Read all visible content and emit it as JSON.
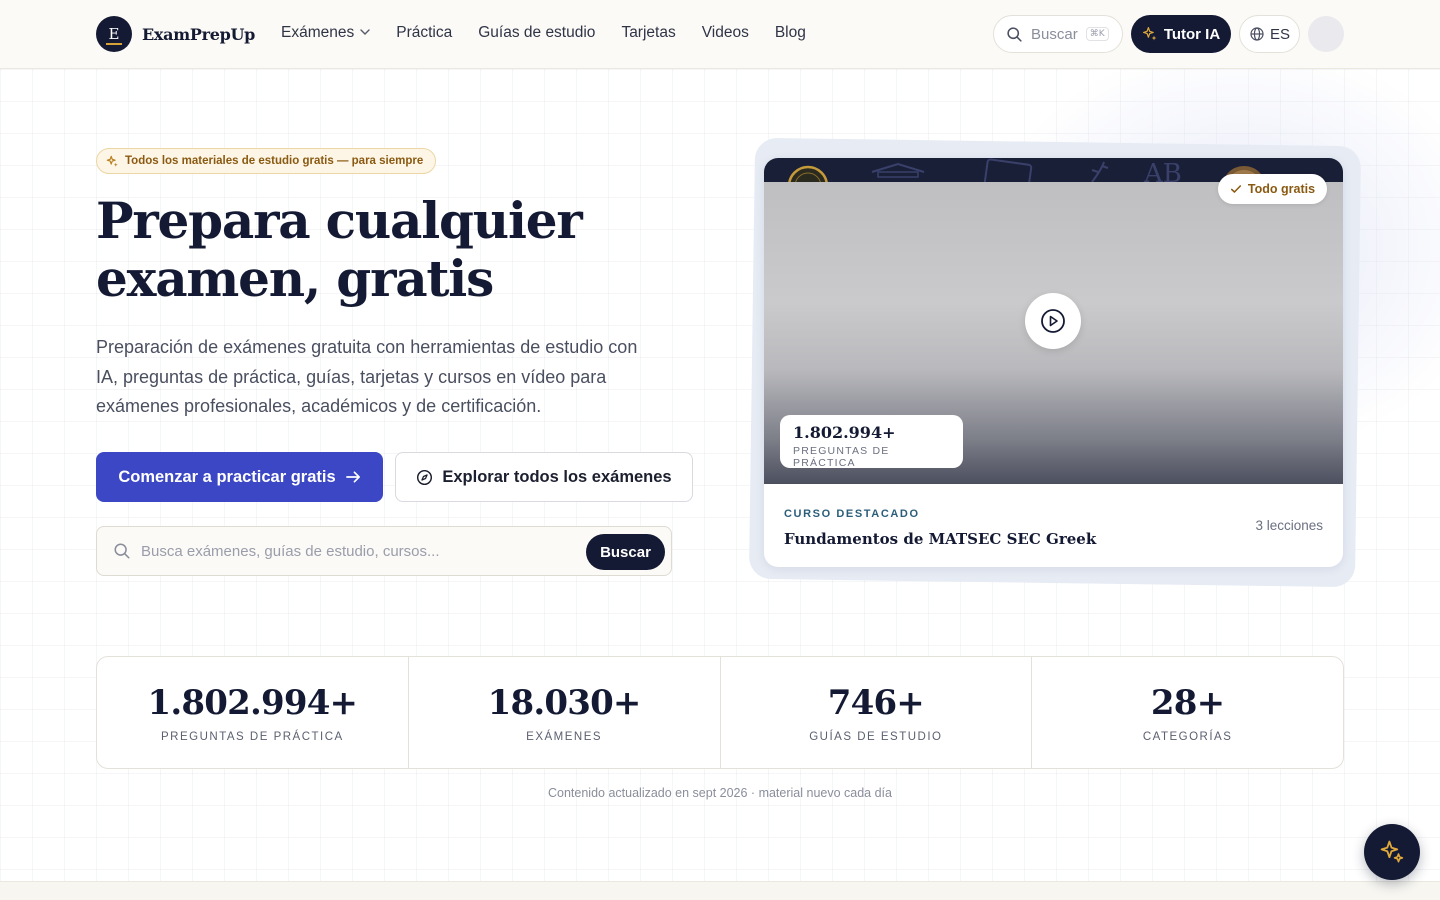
{
  "brand": {
    "initial": "E",
    "name": "ExamPrepUp"
  },
  "nav": {
    "links": [
      "Exámenes",
      "Práctica",
      "Guías de estudio",
      "Tarjetas",
      "Videos",
      "Blog"
    ],
    "search_label": "Buscar",
    "search_shortcut": "⌘K",
    "tutor_label": "Tutor IA",
    "language": "ES"
  },
  "hero": {
    "badge": "Todos los materiales de estudio gratis — para siempre",
    "title_line1": "Prepara cualquier",
    "title_line2": "examen, gratis",
    "subtitle": "Preparación de exámenes gratuita con herramientas de estudio con IA, preguntas de práctica, guías, tarjetas y cursos en vídeo para exámenes profesionales, académicos y de certificación.",
    "cta_primary": "Comenzar a practicar gratis",
    "cta_secondary": "Explorar todos los exámenes",
    "search_placeholder": "Busca exámenes, guías de estudio, cursos...",
    "search_value": "",
    "search_button": "Buscar"
  },
  "featured": {
    "badge": "Todo gratis",
    "stat_value": "1.802.994+",
    "stat_label": "PREGUNTAS DE PRÁCTICA",
    "eyebrow": "CURSO DESTACADO",
    "title": "Fundamentos de MATSEC SEC Greek",
    "lessons": "3 lecciones"
  },
  "stats": [
    {
      "value": "1.802.994+",
      "label": "PREGUNTAS DE PRÁCTICA"
    },
    {
      "value": "18.030+",
      "label": "EXÁMENES"
    },
    {
      "value": "746+",
      "label": "GUÍAS DE ESTUDIO"
    },
    {
      "value": "28+",
      "label": "CATEGORÍAS"
    }
  ],
  "updated_note": "Contenido actualizado en sept 2026 · material nuevo cada día",
  "colors": {
    "navy": "#141a33",
    "primary": "#3b47c4",
    "accent": "#d7a13a",
    "badge_text": "#8a5a12"
  },
  "icons": [
    "search-icon",
    "sparkle-icon",
    "globe-icon",
    "chevron-down-icon",
    "arrow-right-icon",
    "compass-icon",
    "play-icon",
    "check-icon"
  ]
}
